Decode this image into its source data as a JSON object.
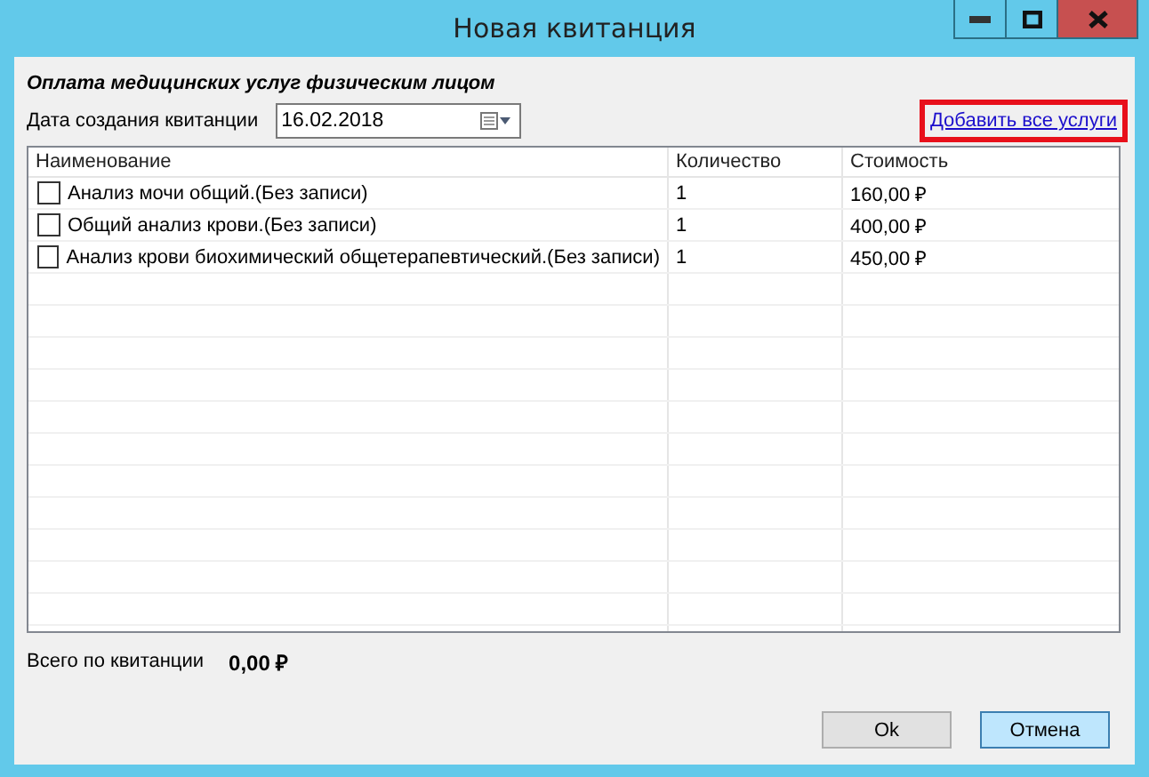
{
  "window": {
    "title": "Новая квитанция"
  },
  "heading": "Оплата медицинских услуг физическим лицом",
  "date": {
    "label": "Дата создания квитанции",
    "value": "16.02.2018"
  },
  "add_all_link": {
    "label": "Добавить все услуги",
    "highlighted": true
  },
  "table": {
    "columns": [
      "Наименование",
      "Количество",
      "Стоимость"
    ],
    "rows": [
      {
        "checked": false,
        "name": "Анализ мочи общий.(Без записи)",
        "quantity": "1",
        "price": "160,00 ₽"
      },
      {
        "checked": false,
        "name": "Общий  анализ крови.(Без записи)",
        "quantity": "1",
        "price": "400,00 ₽"
      },
      {
        "checked": false,
        "name": "Анализ крови биохимический общетерапевтический.(Без записи)",
        "quantity": "1",
        "price": "450,00 ₽"
      }
    ]
  },
  "total": {
    "label": "Всего по квитанции",
    "value": "0,00 ₽"
  },
  "buttons": [
    {
      "label": "Ok",
      "kind": "default"
    },
    {
      "label": "Отмена",
      "kind": "focused"
    }
  ]
}
